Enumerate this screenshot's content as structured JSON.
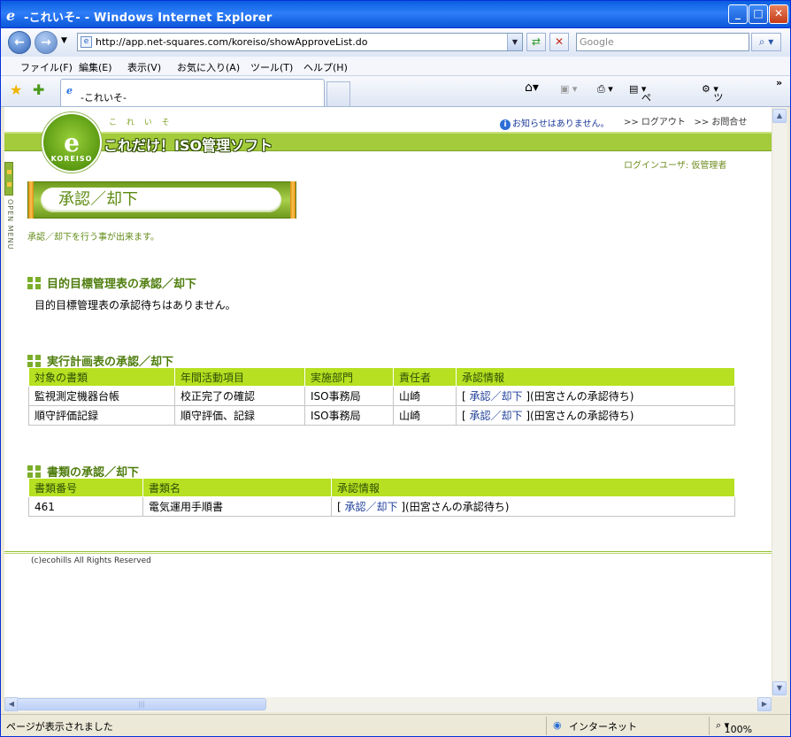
{
  "window": {
    "title": "-これいそ- - Windows Internet Explorer",
    "tab_title": "-これいそ-"
  },
  "address": {
    "url": "http://app.net-squares.com/koreiso/showApproveList.do",
    "search_placeholder": "Google"
  },
  "menu": [
    "ファイル(F)",
    "編集(E)",
    "表示(V)",
    "お気に入り(A)",
    "ツール(T)",
    "ヘルプ(H)"
  ],
  "toolbar": {
    "page": "ページ(P)",
    "tools": "ツール(O)"
  },
  "header": {
    "brand_small": "こ れ い そ",
    "brand": "これだけ！ISO管理ソフト",
    "logo_letter": "e",
    "logo_text": "KOREISO",
    "notice": "お知らせはありません。",
    "logout": ">> ログアウト",
    "contact": ">> お問合せ",
    "login_user": "ログインユーザ:  仮管理者"
  },
  "side": {
    "open_menu": "OPEN MENU"
  },
  "page": {
    "title": "承認／却下",
    "description": "承認／却下を行う事が出来ます。"
  },
  "sections": {
    "objectives": {
      "title": "目的目標管理表の承認／却下",
      "empty": "目的目標管理表の承認待ちはありません。"
    },
    "plans": {
      "title": "実行計画表の承認／却下",
      "columns": [
        "対象の書類",
        "年間活動項目",
        "実施部門",
        "責任者",
        "承認情報"
      ],
      "rows": [
        {
          "doc": "監視測定機器台帳",
          "item": "校正完了の確認",
          "dept": "ISO事務局",
          "owner": "山崎",
          "bracket_open": "[ ",
          "approve": "承認",
          "sep": "／",
          "reject": "却下",
          "bracket_close": " ](田宮さんの承認待ち)"
        },
        {
          "doc": "順守評価記録",
          "item": "順守評価、記録",
          "dept": "ISO事務局",
          "owner": "山崎",
          "bracket_open": "[ ",
          "approve": "承認",
          "sep": "／",
          "reject": "却下",
          "bracket_close": " ](田宮さんの承認待ち)"
        }
      ]
    },
    "documents": {
      "title": "書類の承認／却下",
      "columns": [
        "書類番号",
        "書類名",
        "承認情報"
      ],
      "rows": [
        {
          "no": "461",
          "name": "電気運用手順書",
          "bracket_open": "[ ",
          "approve": "承認",
          "sep": "／",
          "reject": "却下",
          "bracket_close": " ](田宮さんの承認待ち)"
        }
      ]
    }
  },
  "footer": {
    "copyright": "(c)ecohills All Rights Reserved"
  },
  "status": {
    "text": "ページが表示されました",
    "zone": "インターネット",
    "zoom": "100%"
  }
}
